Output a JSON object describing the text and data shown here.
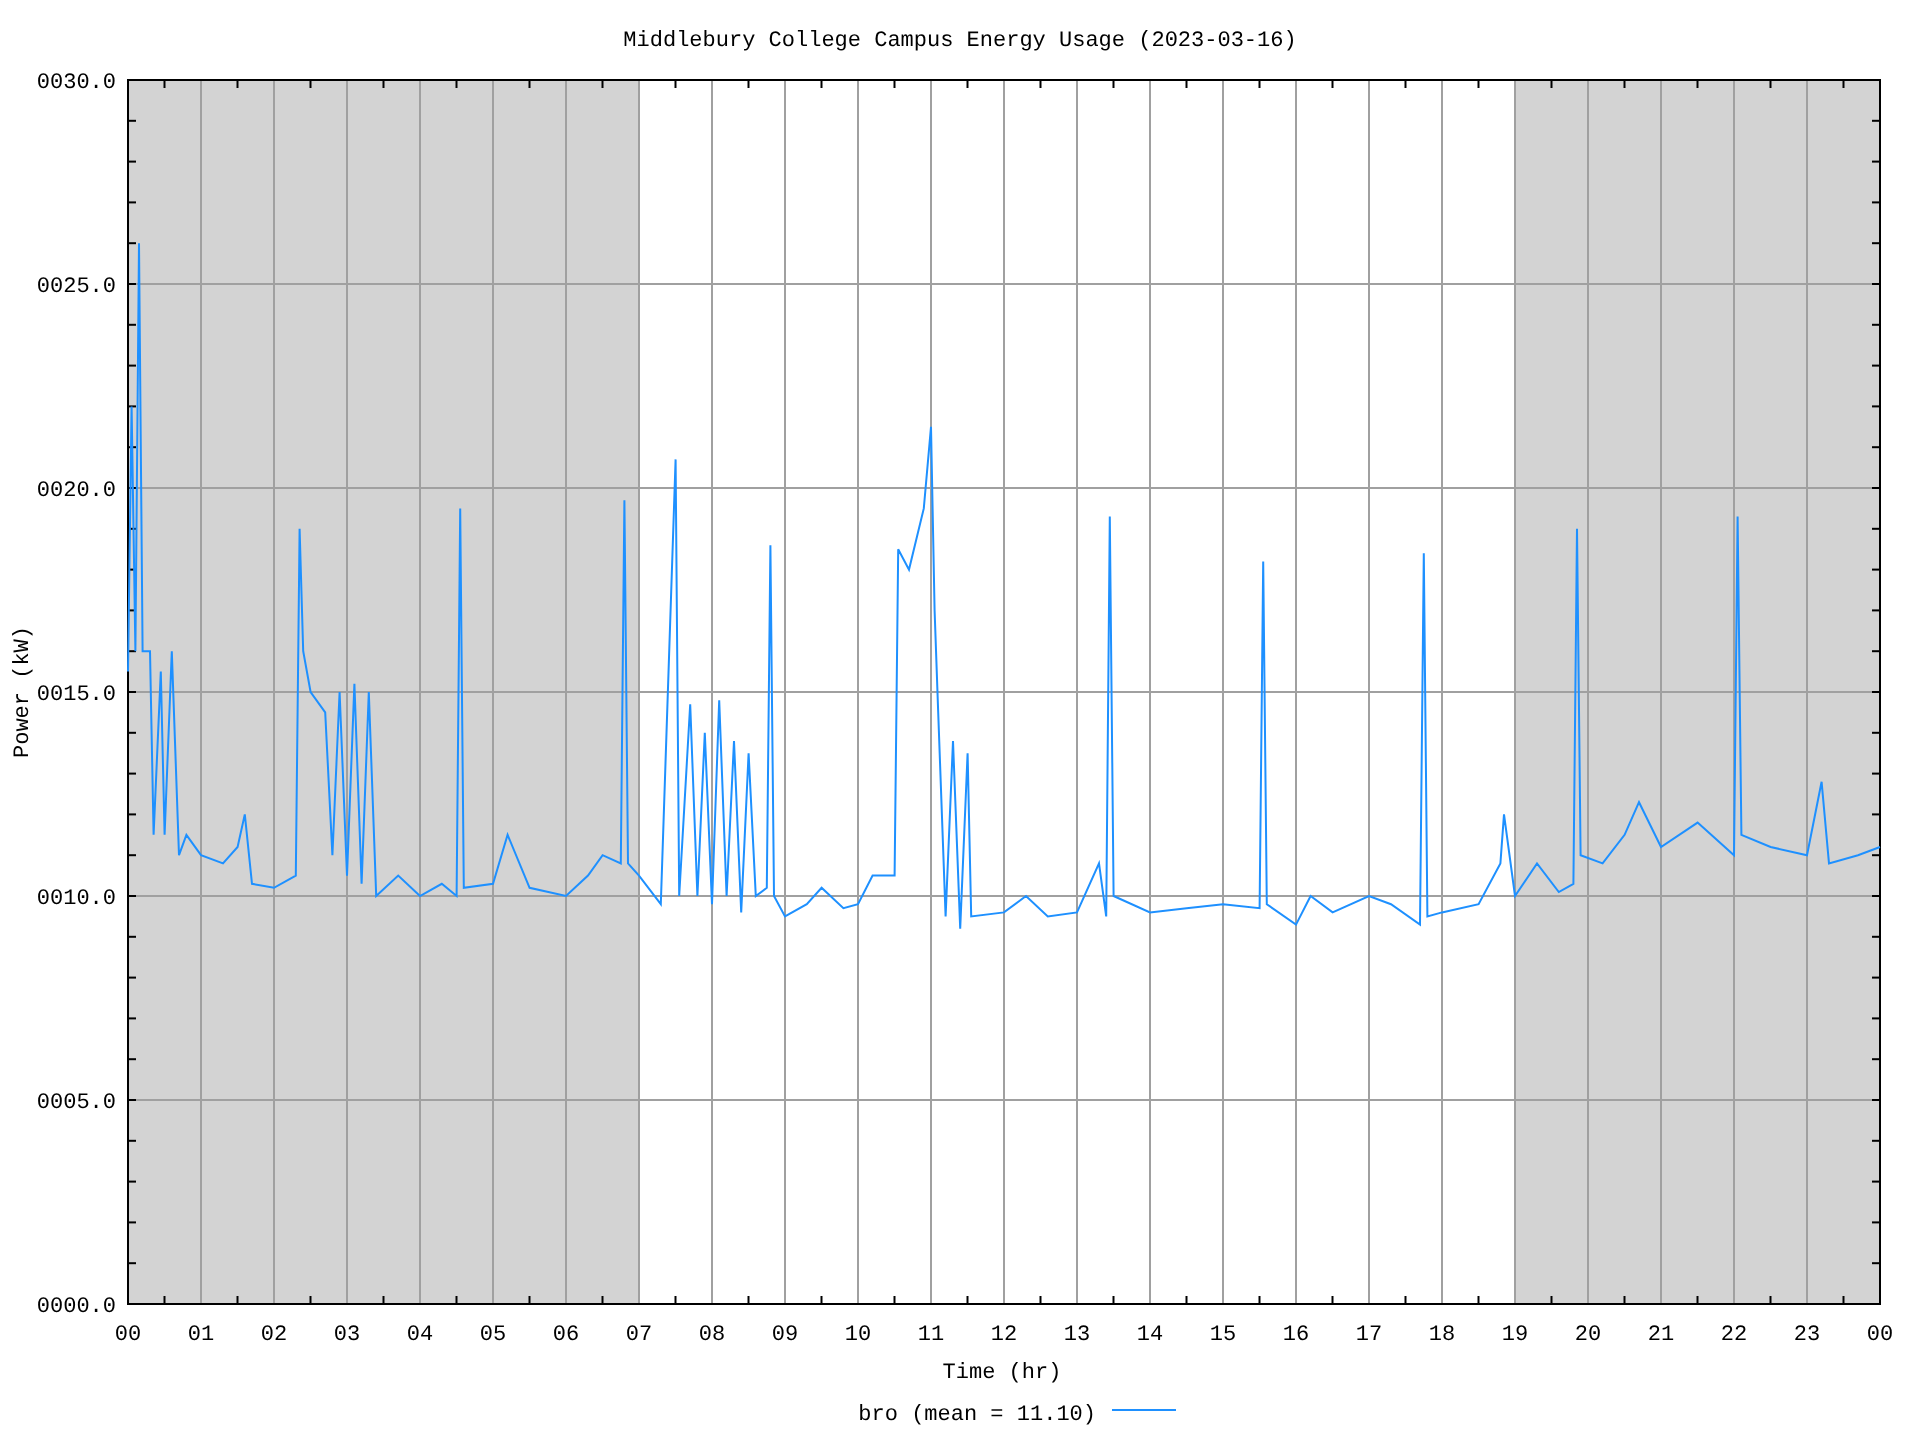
{
  "chart_data": {
    "type": "line",
    "title": "Middlebury College Campus Energy Usage (2023-03-16)",
    "xlabel": "Time (hr)",
    "ylabel": "Power (kW)",
    "xlim": [
      0,
      24
    ],
    "ylim": [
      0,
      30
    ],
    "xticks": [
      {
        "value": 0,
        "label": "00"
      },
      {
        "value": 1,
        "label": "01"
      },
      {
        "value": 2,
        "label": "02"
      },
      {
        "value": 3,
        "label": "03"
      },
      {
        "value": 4,
        "label": "04"
      },
      {
        "value": 5,
        "label": "05"
      },
      {
        "value": 6,
        "label": "06"
      },
      {
        "value": 7,
        "label": "07"
      },
      {
        "value": 8,
        "label": "08"
      },
      {
        "value": 9,
        "label": "09"
      },
      {
        "value": 10,
        "label": "10"
      },
      {
        "value": 11,
        "label": "11"
      },
      {
        "value": 12,
        "label": "12"
      },
      {
        "value": 13,
        "label": "13"
      },
      {
        "value": 14,
        "label": "14"
      },
      {
        "value": 15,
        "label": "15"
      },
      {
        "value": 16,
        "label": "16"
      },
      {
        "value": 17,
        "label": "17"
      },
      {
        "value": 18,
        "label": "18"
      },
      {
        "value": 19,
        "label": "19"
      },
      {
        "value": 20,
        "label": "20"
      },
      {
        "value": 21,
        "label": "21"
      },
      {
        "value": 22,
        "label": "22"
      },
      {
        "value": 23,
        "label": "23"
      },
      {
        "value": 24,
        "label": "00"
      }
    ],
    "yticks": [
      {
        "value": 0,
        "label": "0000.0"
      },
      {
        "value": 5,
        "label": "0005.0"
      },
      {
        "value": 10,
        "label": "0010.0"
      },
      {
        "value": 15,
        "label": "0015.0"
      },
      {
        "value": 20,
        "label": "0020.0"
      },
      {
        "value": 25,
        "label": "0025.0"
      },
      {
        "value": 30,
        "label": "0030.0"
      }
    ],
    "x": [
      0,
      0.05,
      0.1,
      0.15,
      0.2,
      0.3,
      0.35,
      0.45,
      0.5,
      0.6,
      0.7,
      0.8,
      1,
      1.3,
      1.5,
      1.6,
      1.7,
      2,
      2.3,
      2.35,
      2.4,
      2.5,
      2.7,
      2.8,
      2.9,
      3,
      3.1,
      3.2,
      3.3,
      3.4,
      3.7,
      4,
      4.3,
      4.5,
      4.55,
      4.6,
      5,
      5.2,
      5.5,
      6,
      6.3,
      6.5,
      6.75,
      6.8,
      6.85,
      7,
      7.3,
      7.5,
      7.55,
      7.7,
      7.8,
      7.9,
      8,
      8.1,
      8.2,
      8.3,
      8.4,
      8.5,
      8.6,
      8.75,
      8.8,
      8.85,
      9,
      9.3,
      9.5,
      9.8,
      10,
      10.2,
      10.5,
      10.55,
      10.7,
      10.9,
      11,
      11.05,
      11.1,
      11.2,
      11.3,
      11.4,
      11.5,
      11.55,
      12,
      12.3,
      12.6,
      13,
      13.3,
      13.4,
      13.45,
      13.5,
      14,
      14.5,
      15,
      15.5,
      15.55,
      15.6,
      16,
      16.2,
      16.5,
      17,
      17.3,
      17.7,
      17.75,
      17.8,
      18,
      18.5,
      18.8,
      18.85,
      19,
      19.3,
      19.6,
      19.8,
      19.85,
      19.9,
      20.2,
      20.5,
      20.7,
      21,
      21.5,
      22,
      22.05,
      22.1,
      22.5,
      23,
      23.2,
      23.3,
      23.7,
      24
    ],
    "series": [
      {
        "name": "bro (mean = 11.10)",
        "color": "#1e90ff",
        "values": [
          15.5,
          22,
          16,
          26,
          16,
          16,
          11.5,
          15.5,
          11.5,
          16,
          11,
          11.5,
          11,
          10.8,
          11.2,
          12,
          10.3,
          10.2,
          10.5,
          19,
          16,
          15,
          14.5,
          11,
          15,
          10.5,
          15.2,
          10.3,
          15,
          10,
          10.5,
          10,
          10.3,
          10,
          19.5,
          10.2,
          10.3,
          11.5,
          10.2,
          10,
          10.5,
          11,
          10.8,
          19.7,
          10.8,
          10.5,
          9.8,
          20.7,
          10,
          14.7,
          10,
          14,
          9.8,
          14.8,
          10,
          13.8,
          9.6,
          13.5,
          10,
          10.2,
          18.6,
          10,
          9.5,
          9.8,
          10.2,
          9.7,
          9.8,
          10.5,
          10.5,
          18.5,
          18,
          19.5,
          21.5,
          17,
          14.5,
          9.5,
          13.8,
          9.2,
          13.5,
          9.5,
          9.6,
          10,
          9.5,
          9.6,
          10.8,
          9.5,
          19.3,
          10,
          9.6,
          9.7,
          9.8,
          9.7,
          18.2,
          9.8,
          9.3,
          10,
          9.6,
          10,
          9.8,
          9.3,
          18.4,
          9.5,
          9.6,
          9.8,
          10.8,
          12,
          10,
          10.8,
          10.1,
          10.3,
          19,
          11,
          10.8,
          11.5,
          12.3,
          11.2,
          11.8,
          11,
          19.3,
          11.5,
          11.2,
          11,
          12.8,
          10.8,
          11,
          11.2
        ]
      }
    ],
    "grid": true,
    "bands": [
      {
        "axis": "x",
        "from": 0,
        "to": 7
      },
      {
        "axis": "x",
        "from": 19,
        "to": 24
      }
    ]
  }
}
